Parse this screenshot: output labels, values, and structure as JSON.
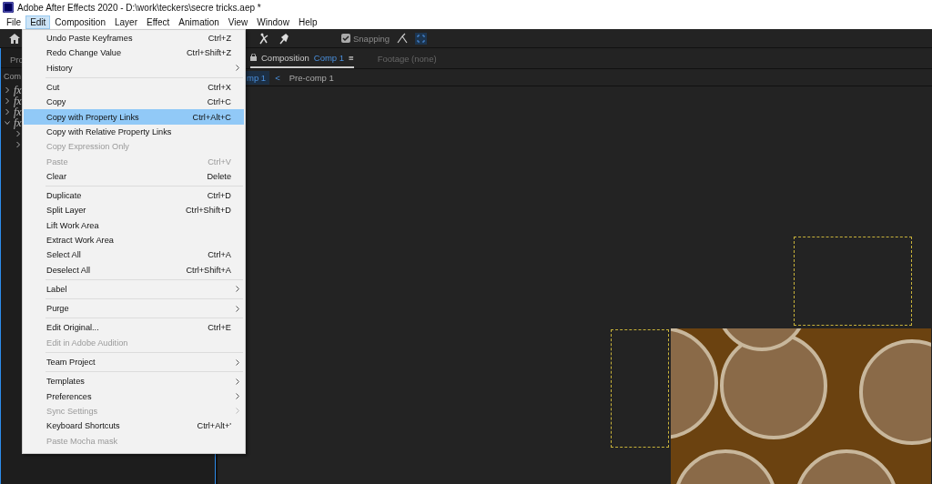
{
  "window": {
    "title": "Adobe After Effects 2020 - D:\\work\\teckers\\secre tricks.aep *"
  },
  "menu_bar": [
    {
      "label": "File",
      "selected": false
    },
    {
      "label": "Edit",
      "selected": true
    },
    {
      "label": "Composition",
      "selected": false
    },
    {
      "label": "Layer",
      "selected": false
    },
    {
      "label": "Effect",
      "selected": false
    },
    {
      "label": "Animation",
      "selected": false
    },
    {
      "label": "View",
      "selected": false
    },
    {
      "label": "Window",
      "selected": false
    },
    {
      "label": "Help",
      "selected": false
    }
  ],
  "toolbar": {
    "snapping": {
      "label": "Snapping",
      "checked": true
    }
  },
  "project_panel": {
    "tab": "Pro",
    "column": "Com",
    "layers": [
      {
        "label": "fx",
        "expanded": false
      },
      {
        "label": "fx",
        "expanded": false
      },
      {
        "label": "fx",
        "expanded": false
      },
      {
        "label": "fx",
        "expanded": true,
        "children": [
          {
            "expanded": false
          },
          {
            "expanded": false
          }
        ]
      }
    ]
  },
  "viewer": {
    "tabs": [
      {
        "label": "Composition",
        "comp": "Comp 1",
        "menu": "≡",
        "selected": true
      },
      {
        "label": "Footage (none)",
        "selected": false
      }
    ],
    "breadcrumbs": [
      {
        "label": "mp 1",
        "selected": true
      },
      {
        "label": "Pre-comp 1",
        "selected": false
      }
    ],
    "breadcrumb_separator": "<"
  },
  "edit_menu": {
    "groups": [
      [
        {
          "label": "Undo Paste Keyframes",
          "shortcut": "Ctrl+Z",
          "submenu": false,
          "disabled": false,
          "selected": false
        },
        {
          "label": "Redo Change Value",
          "shortcut": "Ctrl+Shift+Z",
          "submenu": false,
          "disabled": false,
          "selected": false
        },
        {
          "label": "History",
          "submenu": true,
          "disabled": false,
          "selected": false
        }
      ],
      [
        {
          "label": "Cut",
          "shortcut": "Ctrl+X",
          "submenu": false,
          "disabled": false,
          "selected": false
        },
        {
          "label": "Copy",
          "shortcut": "Ctrl+C",
          "submenu": false,
          "disabled": false,
          "selected": false
        },
        {
          "label": "Copy with Property Links",
          "shortcut": "Ctrl+Alt+C",
          "submenu": false,
          "disabled": false,
          "selected": true
        },
        {
          "label": "Copy with Relative Property Links",
          "submenu": false,
          "disabled": false,
          "selected": false
        },
        {
          "label": "Copy Expression Only",
          "submenu": false,
          "disabled": true,
          "selected": false
        },
        {
          "label": "Paste",
          "shortcut": "Ctrl+V",
          "submenu": false,
          "disabled": true,
          "selected": false
        },
        {
          "label": "Clear",
          "shortcut": "Delete",
          "submenu": false,
          "disabled": false,
          "selected": false
        }
      ],
      [
        {
          "label": "Duplicate",
          "shortcut": "Ctrl+D",
          "submenu": false,
          "disabled": false,
          "selected": false
        },
        {
          "label": "Split Layer",
          "shortcut": "Ctrl+Shift+D",
          "submenu": false,
          "disabled": false,
          "selected": false
        },
        {
          "label": "Lift Work Area",
          "submenu": false,
          "disabled": false,
          "selected": false
        },
        {
          "label": "Extract Work Area",
          "submenu": false,
          "disabled": false,
          "selected": false
        },
        {
          "label": "Select All",
          "shortcut": "Ctrl+A",
          "submenu": false,
          "disabled": false,
          "selected": false
        },
        {
          "label": "Deselect All",
          "shortcut": "Ctrl+Shift+A",
          "submenu": false,
          "disabled": false,
          "selected": false
        }
      ],
      [
        {
          "label": "Label",
          "submenu": true,
          "disabled": false,
          "selected": false
        }
      ],
      [
        {
          "label": "Purge",
          "submenu": true,
          "disabled": false,
          "selected": false
        }
      ],
      [
        {
          "label": "Edit Original...",
          "shortcut": "Ctrl+E",
          "submenu": false,
          "disabled": false,
          "selected": false
        },
        {
          "label": "Edit in Adobe Audition",
          "submenu": false,
          "disabled": true,
          "selected": false
        }
      ],
      [
        {
          "label": "Team Project",
          "submenu": true,
          "disabled": false,
          "selected": false
        }
      ],
      [
        {
          "label": "Templates",
          "submenu": true,
          "disabled": false,
          "selected": false
        },
        {
          "label": "Preferences",
          "submenu": true,
          "disabled": false,
          "selected": false
        },
        {
          "label": "Sync Settings",
          "submenu": true,
          "disabled": true,
          "selected": false
        },
        {
          "label": "Keyboard Shortcuts",
          "shortcut": "Ctrl+Alt+'",
          "submenu": false,
          "disabled": false,
          "selected": false
        },
        {
          "label": "Paste Mocha mask",
          "submenu": false,
          "disabled": true,
          "selected": false
        }
      ]
    ]
  }
}
